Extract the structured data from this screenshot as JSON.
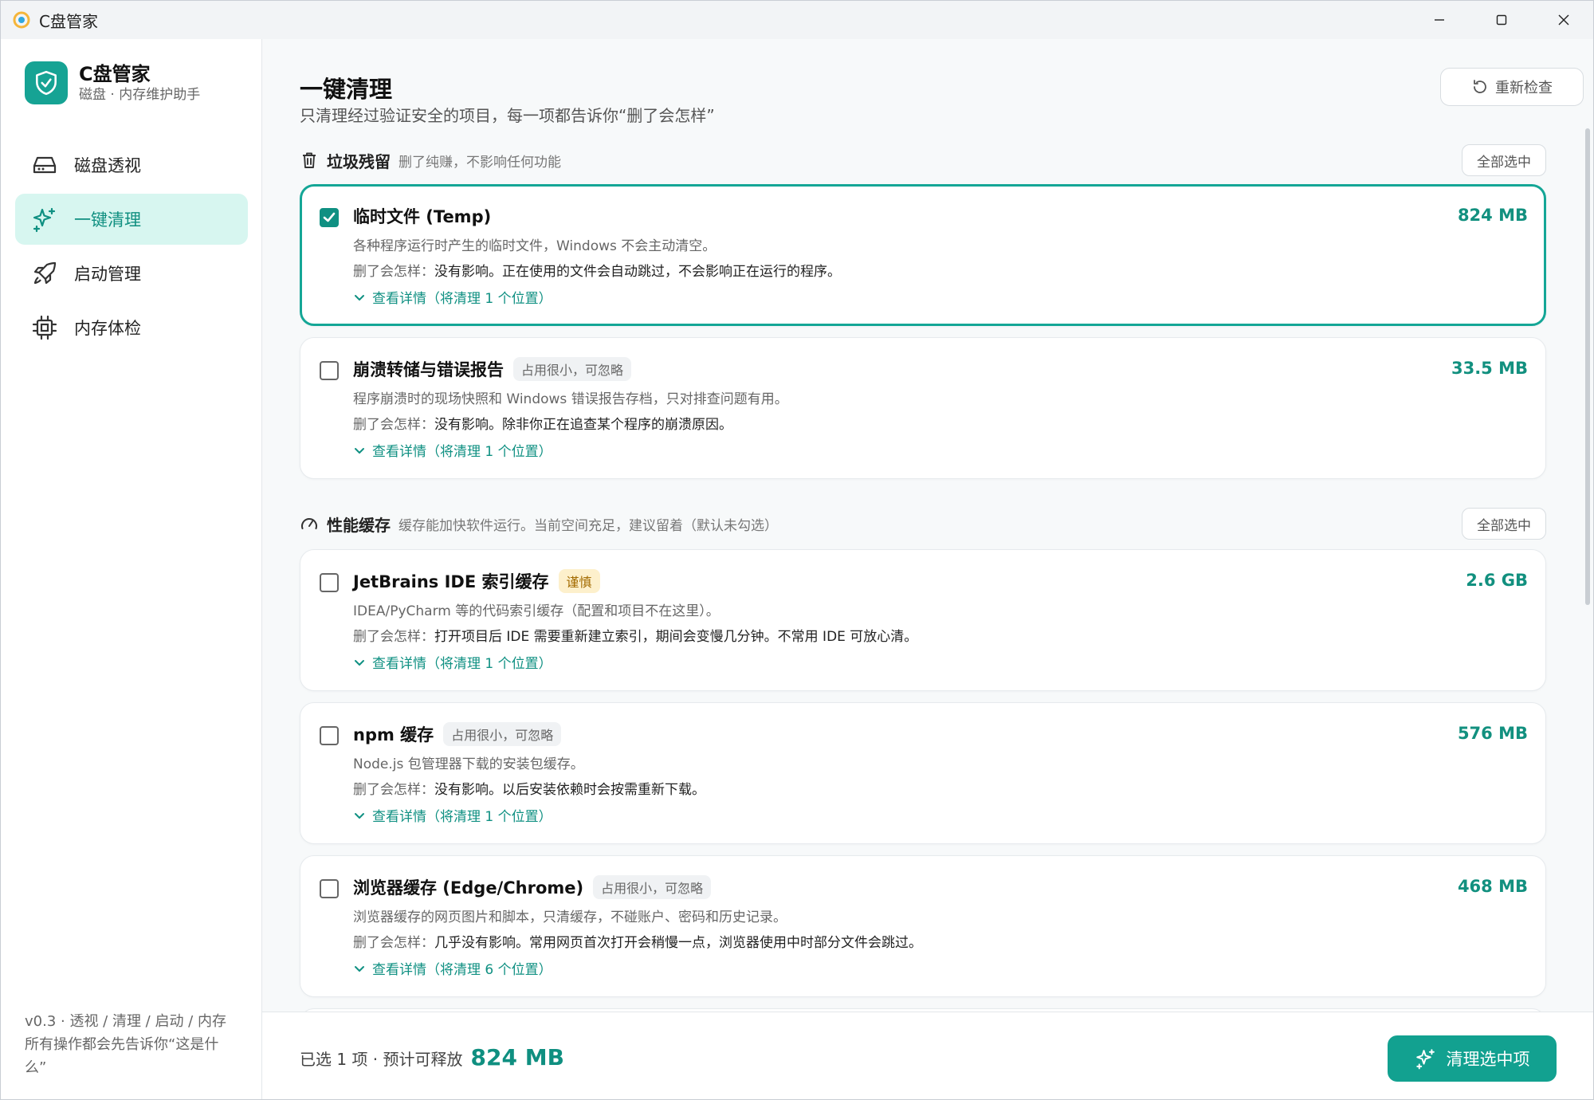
{
  "window": {
    "title": "C盘管家"
  },
  "brand": {
    "name": "C盘管家",
    "subtitle": "磁盘 · 内存维护助手"
  },
  "nav": [
    {
      "label": "磁盘透视",
      "icon": "hard-drive-icon",
      "active": false
    },
    {
      "label": "一键清理",
      "icon": "sparkles-icon",
      "active": true
    },
    {
      "label": "启动管理",
      "icon": "rocket-icon",
      "active": false
    },
    {
      "label": "内存体检",
      "icon": "chip-icon",
      "active": false
    }
  ],
  "sidebar_footer": {
    "line1": "v0.3 · 透视 / 清理 / 启动 / 内存",
    "line2": "所有操作都会先告诉你“这是什么”"
  },
  "page": {
    "title": "一键清理",
    "subtitle": "只清理经过验证安全的项目，每一项都告诉你“删了会怎样”",
    "recheck_label": "重新检查"
  },
  "sections": [
    {
      "title": "垃圾残留",
      "desc": "删了纯赚，不影响任何功能",
      "select_all": "全部选中",
      "icon": "trash-icon",
      "items": [
        {
          "name": "临时文件 (Temp)",
          "badge": "",
          "size": "824 MB",
          "checked": true,
          "desc": "各种程序运行时产生的临时文件，Windows 不会主动清空。",
          "effect_label": "删了会怎样：",
          "effect": "没有影响。正在使用的文件会自动跳过，不会影响正在运行的程序。",
          "details": "查看详情（将清理 1 个位置）"
        },
        {
          "name": "崩溃转储与错误报告",
          "badge": "占用很小，可忽略",
          "size": "33.5 MB",
          "checked": false,
          "desc": "程序崩溃时的现场快照和 Windows 错误报告存档，只对排查问题有用。",
          "effect_label": "删了会怎样：",
          "effect": "没有影响。除非你正在追查某个程序的崩溃原因。",
          "details": "查看详情（将清理 1 个位置）"
        }
      ]
    },
    {
      "title": "性能缓存",
      "desc": "缓存能加快软件运行。当前空间充足，建议留着（默认未勾选）",
      "select_all": "全部选中",
      "icon": "gauge-icon",
      "items": [
        {
          "name": "JetBrains IDE 索引缓存",
          "badge": "谨慎",
          "badge_type": "warn",
          "size": "2.6 GB",
          "checked": false,
          "desc": "IDEA/PyCharm 等的代码索引缓存（配置和项目不在这里）。",
          "effect_label": "删了会怎样：",
          "effect": "打开项目后 IDE 需要重新建立索引，期间会变慢几分钟。不常用 IDE 可放心清。",
          "details": "查看详情（将清理 1 个位置）"
        },
        {
          "name": "npm 缓存",
          "badge": "占用很小，可忽略",
          "size": "576 MB",
          "checked": false,
          "desc": "Node.js 包管理器下载的安装包缓存。",
          "effect_label": "删了会怎样：",
          "effect": "没有影响。以后安装依赖时会按需重新下载。",
          "details": "查看详情（将清理 1 个位置）"
        },
        {
          "name": "浏览器缓存 (Edge/Chrome)",
          "badge": "占用很小，可忽略",
          "size": "468 MB",
          "checked": false,
          "desc": "浏览器缓存的网页图片和脚本，只清缓存，不碰账户、密码和历史记录。",
          "effect_label": "删了会怎样：",
          "effect": "几乎没有影响。常用网页首次打开会稍慢一点，浏览器使用中时部分文件会跳过。",
          "details": "查看详情（将清理 6 个位置）"
        }
      ]
    }
  ],
  "footer": {
    "summary": "已选 1 项 · 预计可释放",
    "size": "824 MB",
    "clean_label": "清理选中项"
  },
  "colors": {
    "accent": "#12a190",
    "accent_light": "#d7f6f0",
    "warn_bg": "#fdf0cc",
    "warn_text": "#a36b00"
  }
}
